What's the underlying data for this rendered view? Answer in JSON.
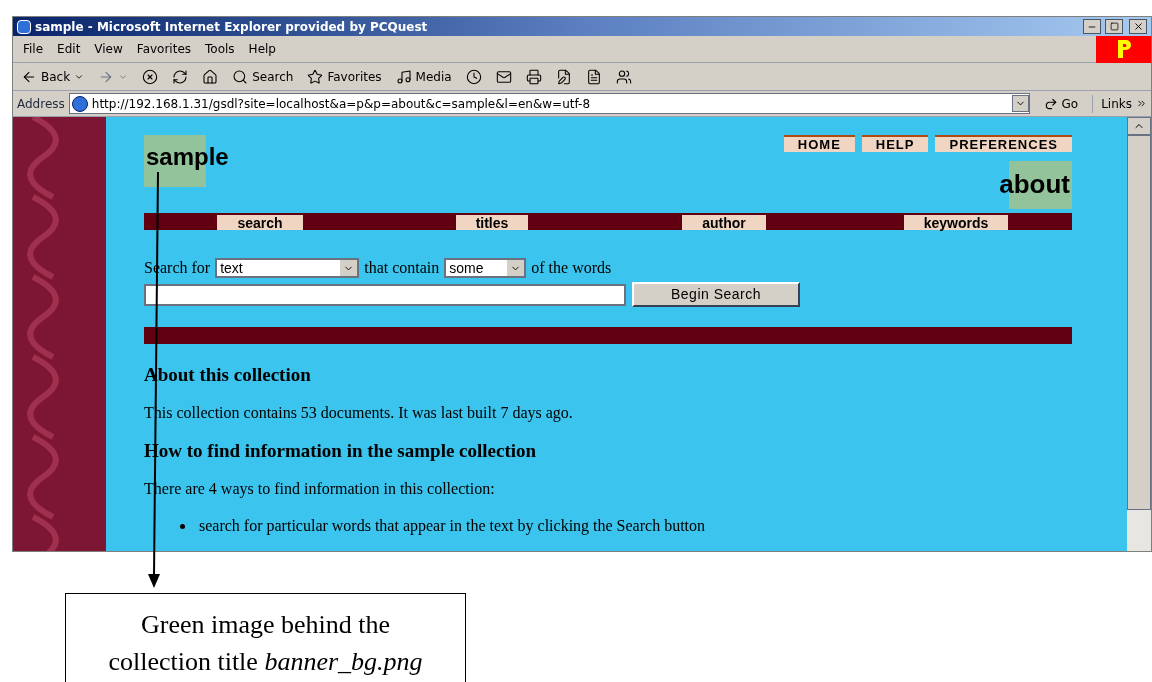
{
  "window": {
    "title": "sample - Microsoft Internet Explorer provided by PCQuest"
  },
  "menu": [
    "File",
    "Edit",
    "View",
    "Favorites",
    "Tools",
    "Help"
  ],
  "toolbar": [
    {
      "kind": "back",
      "label": "Back"
    },
    {
      "kind": "forward"
    },
    {
      "kind": "stop"
    },
    {
      "kind": "refresh"
    },
    {
      "kind": "home"
    },
    {
      "kind": "search",
      "label": "Search"
    },
    {
      "kind": "favorites",
      "label": "Favorites"
    },
    {
      "kind": "media",
      "label": "Media"
    },
    {
      "kind": "history"
    },
    {
      "kind": "mail"
    },
    {
      "kind": "print"
    },
    {
      "kind": "edit"
    },
    {
      "kind": "discuss"
    },
    {
      "kind": "messenger"
    }
  ],
  "address": {
    "label": "Address",
    "value": "http://192.168.1.31/gsdl?site=localhost&a=p&p=about&c=sample&l=en&w=utf-8",
    "go": "Go",
    "links": "Links"
  },
  "page": {
    "collection_title": "sample",
    "top_links": [
      "HOME",
      "HELP",
      "PREFERENCES"
    ],
    "page_title": "about",
    "nav": [
      "search",
      "titles",
      "author",
      "keywords"
    ],
    "search_form": {
      "label": "Search for",
      "field_select": "text",
      "middle": "that contain",
      "mode_select": "some",
      "end": "of the words",
      "button": "Begin Search"
    },
    "sections": [
      {
        "kind": "heading",
        "text": "About this collection"
      },
      {
        "kind": "para",
        "text": "This collection contains 53 documents. It was last built 7 days ago."
      },
      {
        "kind": "heading",
        "text": "How to find information in the sample collection"
      },
      {
        "kind": "para",
        "text": "There are 4 ways to find information in this collection:"
      },
      {
        "kind": "bullet",
        "text": "search for particular words that appear in the text by clicking the Search button"
      }
    ]
  },
  "callout": [
    "Green image behind the",
    "collection title *banner_bg.png*"
  ]
}
